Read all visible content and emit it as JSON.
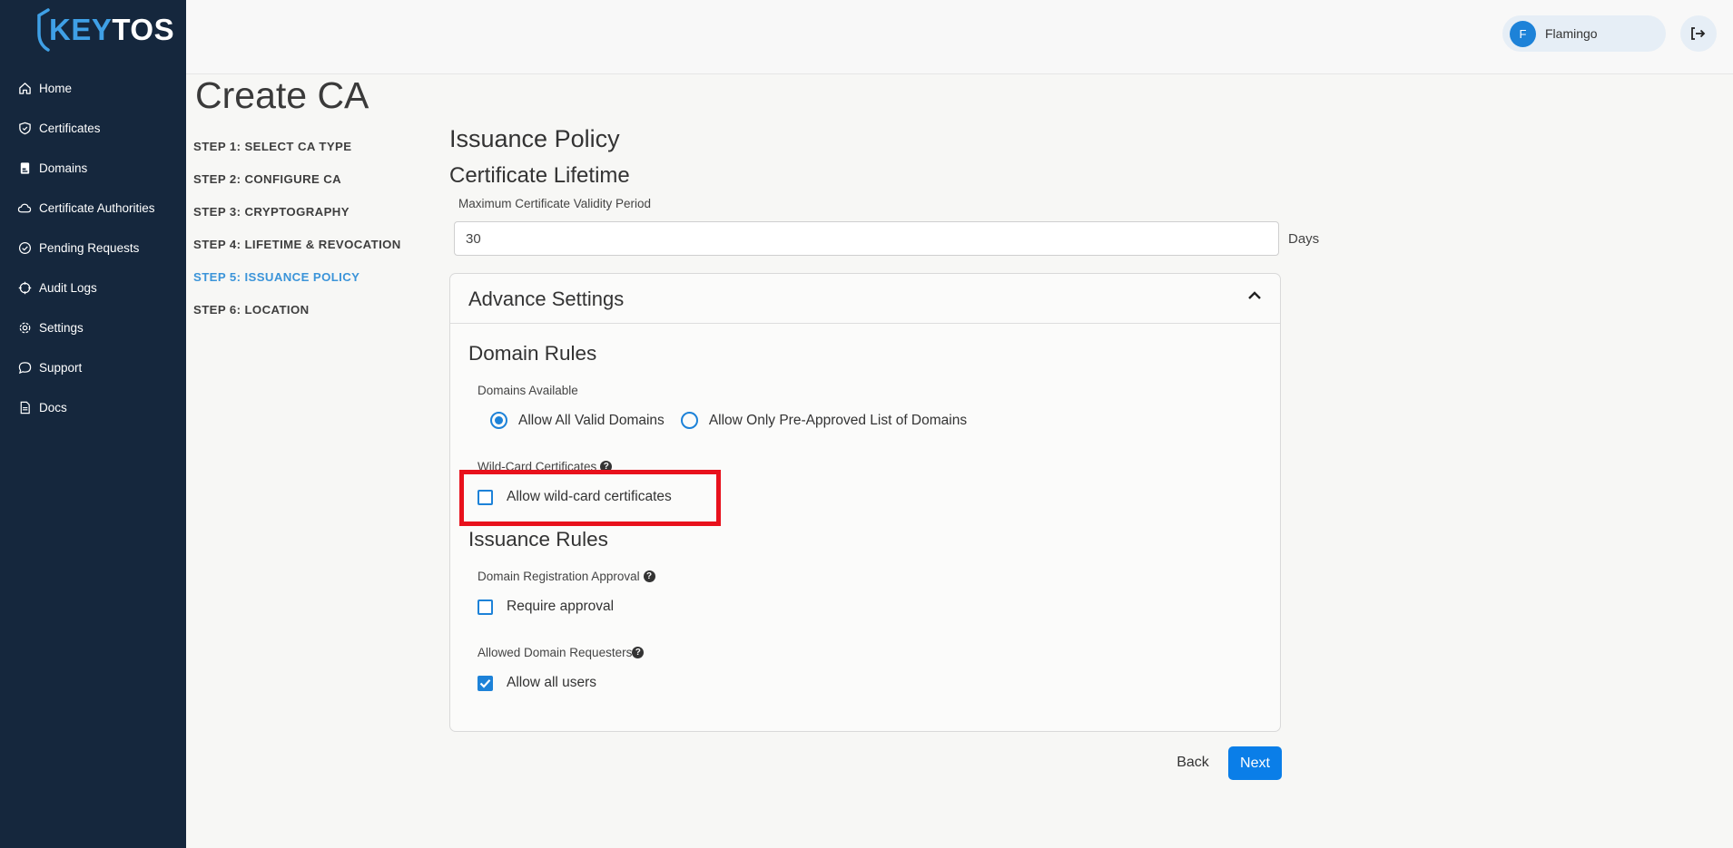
{
  "brand": {
    "logo_k": "KEY",
    "logo_t": "TOS"
  },
  "sidebar": {
    "items": [
      {
        "label": "Home",
        "icon": "home-icon"
      },
      {
        "label": "Certificates",
        "icon": "shield-icon"
      },
      {
        "label": "Domains",
        "icon": "domain-doc-icon"
      },
      {
        "label": "Certificate Authorities",
        "icon": "cloud-icon"
      },
      {
        "label": "Pending Requests",
        "icon": "check-circle-icon"
      },
      {
        "label": "Audit Logs",
        "icon": "crosshair-icon"
      },
      {
        "label": "Settings",
        "icon": "gear-icon"
      },
      {
        "label": "Support",
        "icon": "chat-bubble-icon"
      },
      {
        "label": "Docs",
        "icon": "document-icon"
      }
    ]
  },
  "header": {
    "user_initial": "F",
    "user_name": "Flamingo"
  },
  "page": {
    "title": "Create CA",
    "steps": [
      "STEP 1: SELECT CA TYPE",
      "STEP 2: CONFIGURE CA",
      "STEP 3: CRYPTOGRAPHY",
      "STEP 4: LIFETIME & REVOCATION",
      "STEP 5: ISSUANCE POLICY",
      "STEP 6: LOCATION"
    ],
    "active_step": 4
  },
  "form": {
    "section_title": "Issuance Policy",
    "lifetime_title": "Certificate Lifetime",
    "validity_label": "Maximum Certificate Validity Period",
    "validity_value": "30",
    "validity_unit": "Days",
    "advanced_title": "Advance Settings",
    "domain_rules_title": "Domain Rules",
    "domains_available_label": "Domains Available",
    "radio_all": "Allow All Valid Domains",
    "radio_preapproved": "Allow Only Pre-Approved List of Domains",
    "wildcard_label": "Wild-Card Certificates",
    "wildcard_checkbox": "Allow wild-card certificates",
    "issuance_rules_title": "Issuance Rules",
    "registration_label": "Domain Registration Approval",
    "require_approval": "Require approval",
    "requesters_label": "Allowed Domain Requesters",
    "allow_all_users": "Allow all users",
    "help_glyph": "?"
  },
  "actions": {
    "back": "Back",
    "next": "Next"
  },
  "colors": {
    "sidebar": "#15273d",
    "accent": "#1d82d8",
    "active_step": "#3b94d9",
    "highlight": "#e8111c",
    "primary_button": "#0a7ee8"
  }
}
